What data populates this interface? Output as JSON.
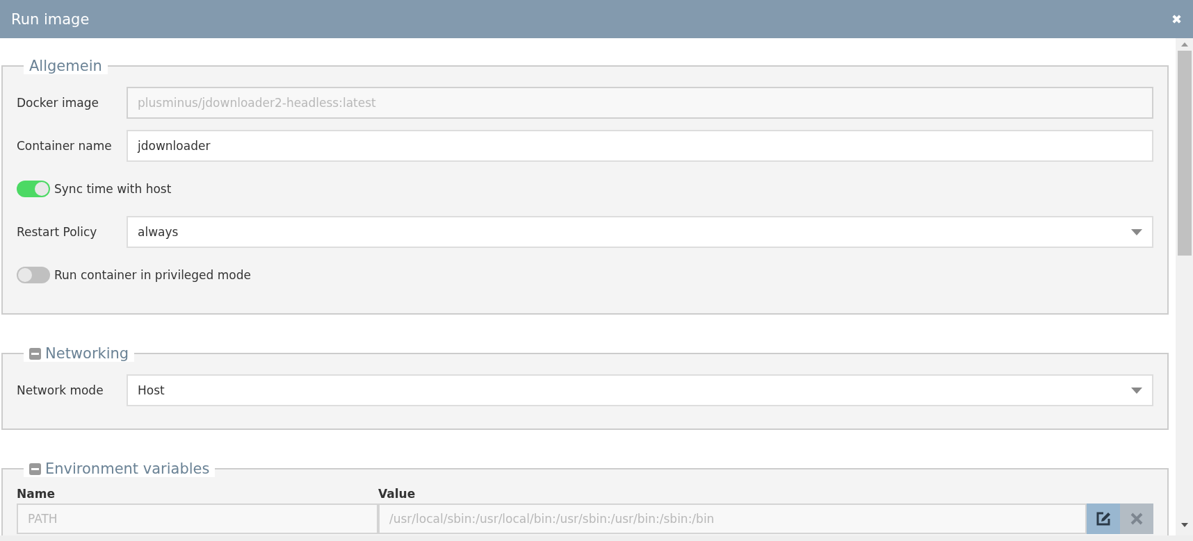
{
  "window": {
    "title": "Run image",
    "close": "✖"
  },
  "sections": [
    {
      "title": "Allgemein",
      "collapsible": false,
      "kind": "form",
      "rows": [
        {
          "kind": "text",
          "label": "Docker image",
          "value": "plusminus/jdownloader2-headless:latest",
          "disabled": true
        },
        {
          "kind": "text",
          "label": "Container name",
          "value": "jdownloader",
          "disabled": false
        },
        {
          "kind": "toggle",
          "label": "Sync time with host",
          "on": true
        },
        {
          "kind": "select",
          "label": "Restart Policy",
          "value": "always"
        },
        {
          "kind": "toggle",
          "label": "Run container in privileged mode",
          "on": false
        }
      ]
    },
    {
      "title": "Networking",
      "collapsible": true,
      "kind": "form",
      "rows": [
        {
          "kind": "select",
          "label": "Network mode",
          "value": "Host"
        }
      ]
    },
    {
      "title": "Environment variables",
      "collapsible": true,
      "kind": "table",
      "columns": [
        "Name",
        "Value"
      ],
      "rows": [
        {
          "name": "PATH",
          "value": "/usr/local/sbin:/usr/local/bin:/usr/sbin:/usr/bin:/sbin:/bin",
          "disabled": true
        }
      ]
    }
  ]
}
